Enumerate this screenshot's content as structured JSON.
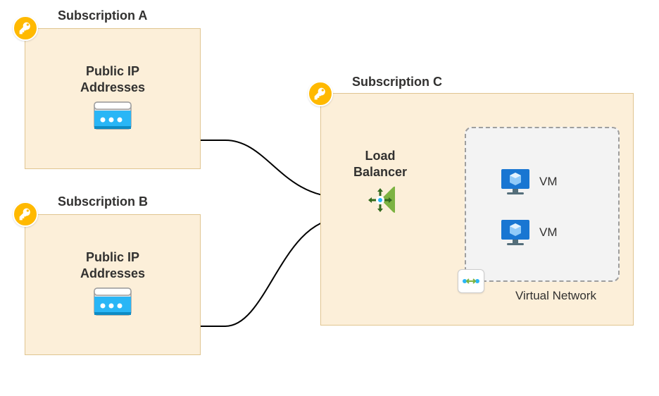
{
  "diagram": {
    "subscriptionA": {
      "title": "Subscription A",
      "resource_label_line1": "Public IP",
      "resource_label_line2": "Addresses"
    },
    "subscriptionB": {
      "title": "Subscription B",
      "resource_label_line1": "Public IP",
      "resource_label_line2": "Addresses"
    },
    "subscriptionC": {
      "title": "Subscription C",
      "load_balancer_label_line1": "Load",
      "load_balancer_label_line2": "Balancer",
      "vnet": {
        "label": "Virtual Network",
        "vm1_label": "VM",
        "vm2_label": "VM"
      }
    }
  }
}
